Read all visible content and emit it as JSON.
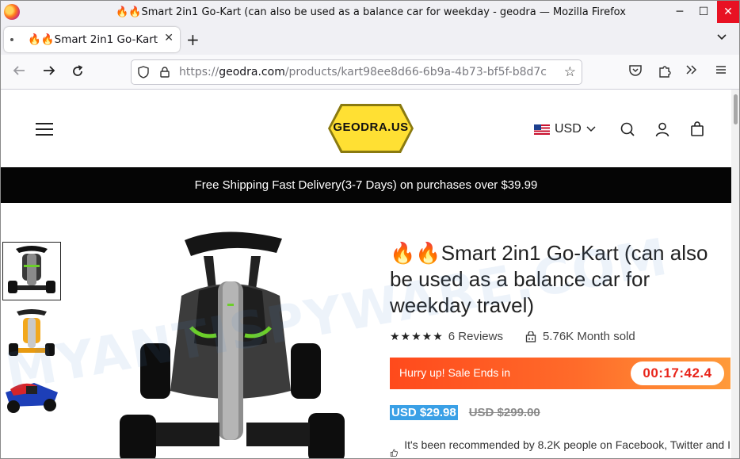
{
  "window": {
    "title": "🔥🔥Smart 2in1 Go-Kart (can also be used as a balance car for weekday - geodra — Mozilla Firefox",
    "minimize_glyph": "─",
    "maximize_glyph": "☐",
    "close_glyph": "✕"
  },
  "tab": {
    "label": "🔥🔥Smart 2in1 Go-Kart (can also be used as a balance car for weekday",
    "close_glyph": "✕",
    "new_tab_glyph": "+",
    "list_glyph": "⌄"
  },
  "urlbar": {
    "scheme": "https://",
    "host": "geodra.com",
    "path": "/products/kart98ee8d66-6b9a-4b73-bf5f-b8d7c"
  },
  "site": {
    "logo_text": "GEODRA.US",
    "currency": "USD",
    "announcement": "Free Shipping Fast Delivery(3-7 Days) on purchases over $39.99"
  },
  "product": {
    "title": "🔥🔥Smart 2in1 Go-Kart (can also be used as a balance car for weekday travel)",
    "reviews": "6 Reviews",
    "sold": "5.76K Month sold",
    "sale_text": "Hurry up! Sale Ends in",
    "timer": "00:17:42.4",
    "price_now": "USD $29.98",
    "price_old": "USD $299.00",
    "recommend_text": "It's been recommended by 8.2K people on Facebook, Twitter and I"
  },
  "watermark": "MYANTISPYWARE.COM",
  "colors": {
    "sale_bar": "#ff4a1c",
    "timer_text": "#e8251b",
    "price_highlight": "#3aa0e6",
    "logo_fill": "#ffe033"
  }
}
